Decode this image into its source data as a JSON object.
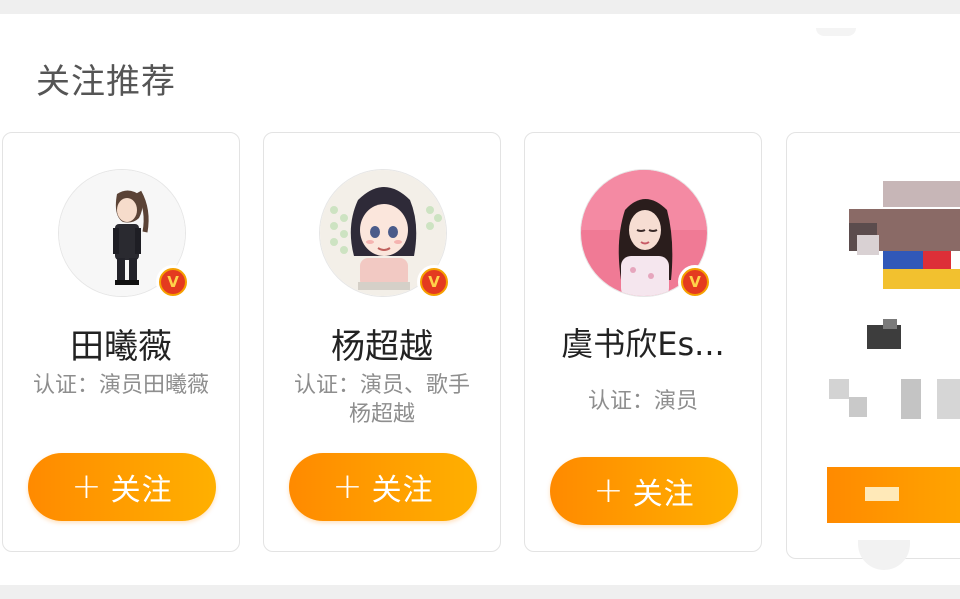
{
  "section": {
    "title": "关注推荐"
  },
  "cards": [
    {
      "name": "田曦薇",
      "desc": "认证：演员田曦薇",
      "button": "关注",
      "badge": "V"
    },
    {
      "name": "杨超越",
      "desc": "认证：演员、歌手杨超越",
      "button": "关注",
      "badge": "V"
    },
    {
      "name": "虞书欣Es...",
      "desc": "认证：演员",
      "button": "关注",
      "badge": "V"
    }
  ],
  "colors": {
    "button_start": "#ff8a00",
    "button_end": "#ffb000",
    "badge_outer": "#f5a000",
    "badge_inner": "#e43a1f"
  }
}
